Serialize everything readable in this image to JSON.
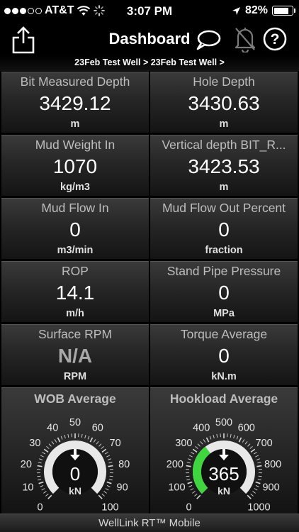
{
  "status": {
    "carrier": "AT&T",
    "time": "3:07 PM",
    "battery": "82%",
    "battery_level": 0.82,
    "signal_bars": 3
  },
  "nav": {
    "title": "Dashboard",
    "breadcrumb": "23Feb Test Well > 23Feb Test Well >"
  },
  "tiles": [
    {
      "label": "Bit Measured Depth",
      "value": "3429.12",
      "unit": "m"
    },
    {
      "label": "Hole Depth",
      "value": "3430.63",
      "unit": "m"
    },
    {
      "label": "Mud Weight In",
      "value": "1070",
      "unit": "kg/m3"
    },
    {
      "label": "Vertical depth BIT_R...",
      "value": "3423.53",
      "unit": "m"
    },
    {
      "label": "Mud Flow In",
      "value": "0",
      "unit": "m3/min"
    },
    {
      "label": "Mud Flow Out Percent",
      "value": "0",
      "unit": "fraction"
    },
    {
      "label": "ROP",
      "value": "14.1",
      "unit": "m/h"
    },
    {
      "label": "Stand Pipe Pressure",
      "value": "0",
      "unit": "MPa"
    },
    {
      "label": "Surface RPM",
      "value": "N/A",
      "unit": "RPM"
    },
    {
      "label": "Torque Average",
      "value": "0",
      "unit": "kN.m"
    }
  ],
  "gauges": [
    {
      "label": "WOB Average",
      "value": "0",
      "unit": "kN",
      "min": 0,
      "max": 100,
      "reading": 0,
      "ticks": [
        "0",
        "10",
        "20",
        "30",
        "40",
        "50",
        "60",
        "70",
        "80",
        "90",
        "100"
      ],
      "arc_color": "#ffffff",
      "fill_color": "#3ed53e"
    },
    {
      "label": "Hookload Average",
      "value": "365",
      "unit": "kN",
      "min": 0,
      "max": 1000,
      "reading": 365,
      "ticks": [
        "0",
        "100",
        "200",
        "300",
        "400",
        "500",
        "600",
        "700",
        "800",
        "900",
        "1000"
      ],
      "arc_color": "#ffffff",
      "fill_color": "#3ed53e"
    }
  ],
  "footer": {
    "text": "WellLink RT™ Mobile"
  }
}
